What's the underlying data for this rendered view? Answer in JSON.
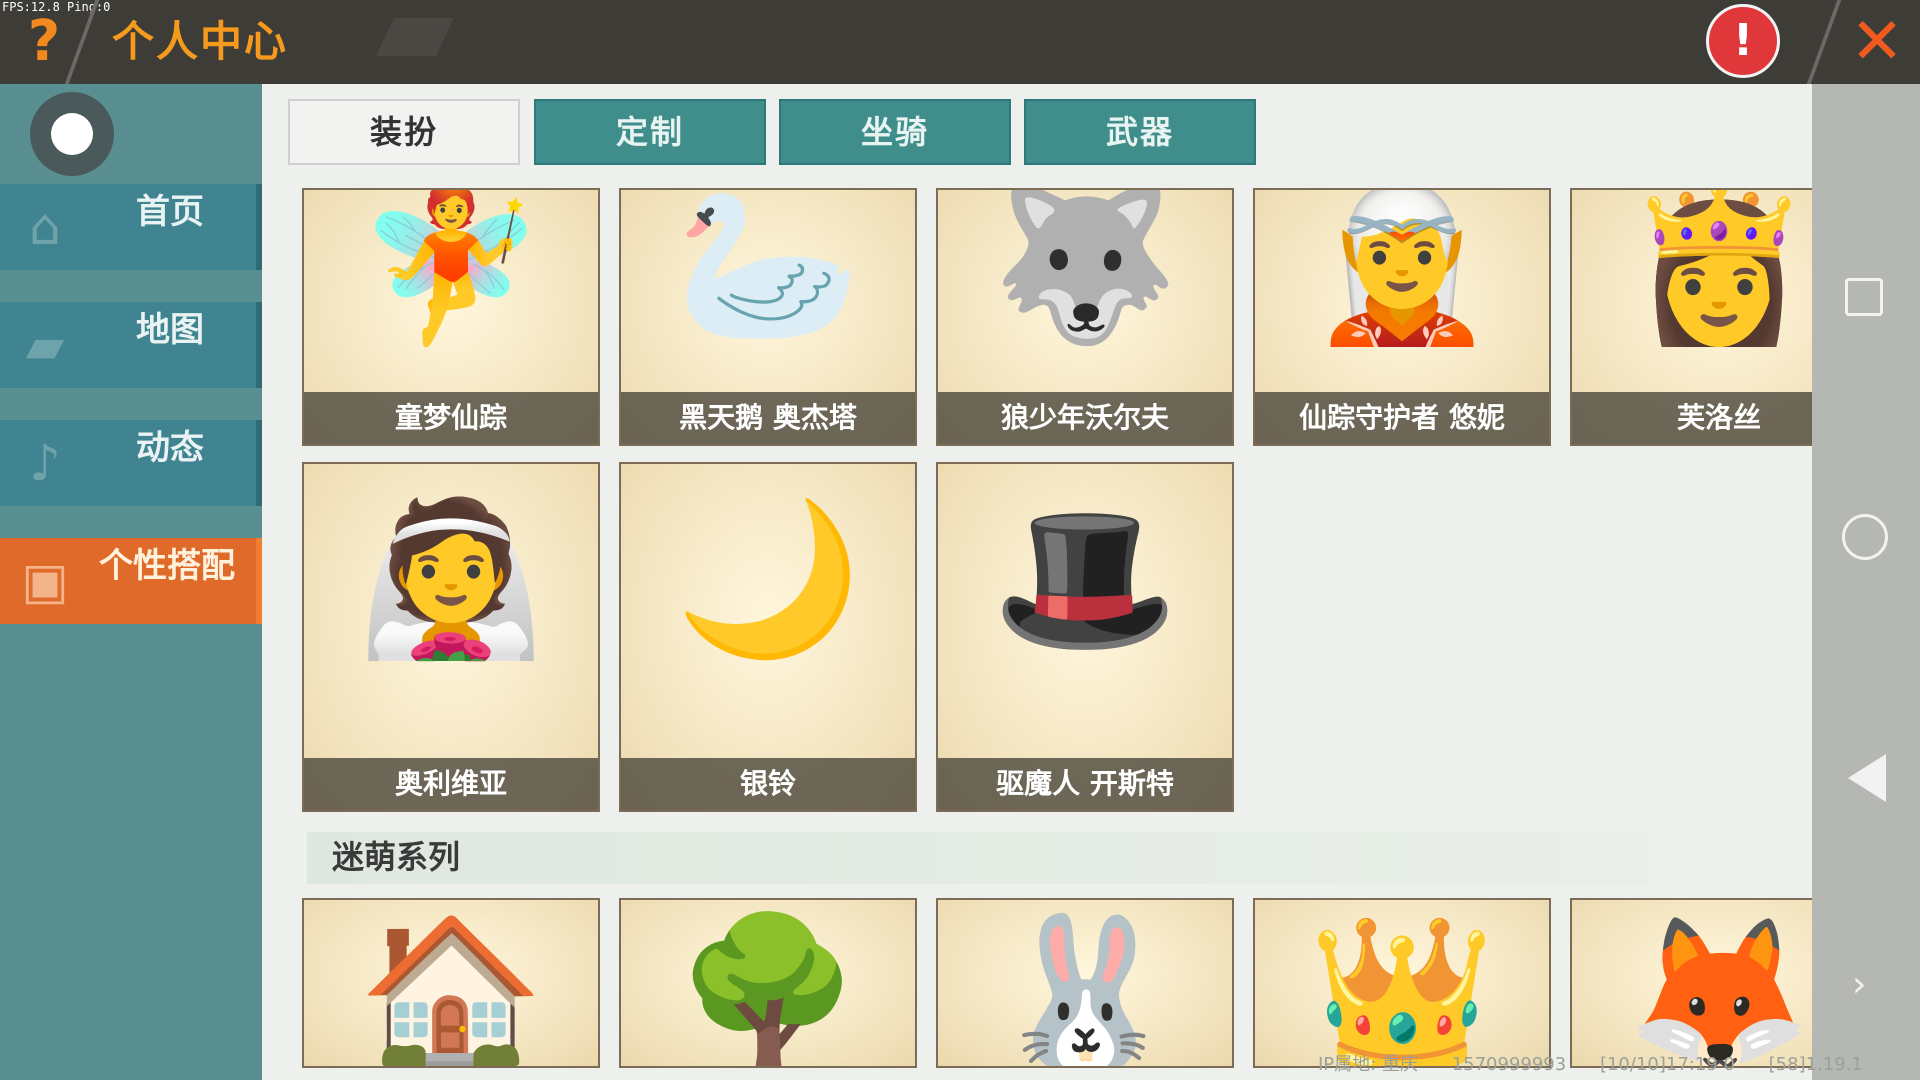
{
  "debug": "FPS:12.8  Ping:0",
  "header": {
    "title": "个人中心",
    "help_glyph": "?",
    "report_glyph": "!",
    "close_glyph": "✕"
  },
  "sidebar": {
    "items": [
      {
        "label": "首页",
        "icon": "home-icon",
        "active": false
      },
      {
        "label": "地图",
        "icon": "map-icon",
        "active": false
      },
      {
        "label": "动态",
        "icon": "bell-icon",
        "active": false
      },
      {
        "label": "个性搭配",
        "icon": "character-icon",
        "active": true
      }
    ]
  },
  "tabs": [
    {
      "label": "装扮",
      "active": true
    },
    {
      "label": "定制",
      "active": false
    },
    {
      "label": "坐骑",
      "active": false
    },
    {
      "label": "武器",
      "active": false
    }
  ],
  "outfits": [
    {
      "name": "童梦仙踪"
    },
    {
      "name": "黑天鹅 奥杰塔"
    },
    {
      "name": "狼少年沃尔夫"
    },
    {
      "name": "仙踪守护者 悠妮"
    },
    {
      "name": "芙洛丝"
    },
    {
      "name": "奥利维亚"
    },
    {
      "name": "银铃"
    },
    {
      "name": "驱魔人 开斯特"
    }
  ],
  "section": {
    "title": "迷萌系列"
  },
  "footer": {
    "ip": "IP属地: 重庆",
    "uid": "1570999993",
    "time": "[10/10]17:19 0",
    "version": "[58]1.19.1"
  },
  "colors": {
    "accent": "#e06a2a",
    "teal": "#3f8e8c",
    "sidebar": "#5a8f92",
    "topbar": "#3e3c37"
  }
}
